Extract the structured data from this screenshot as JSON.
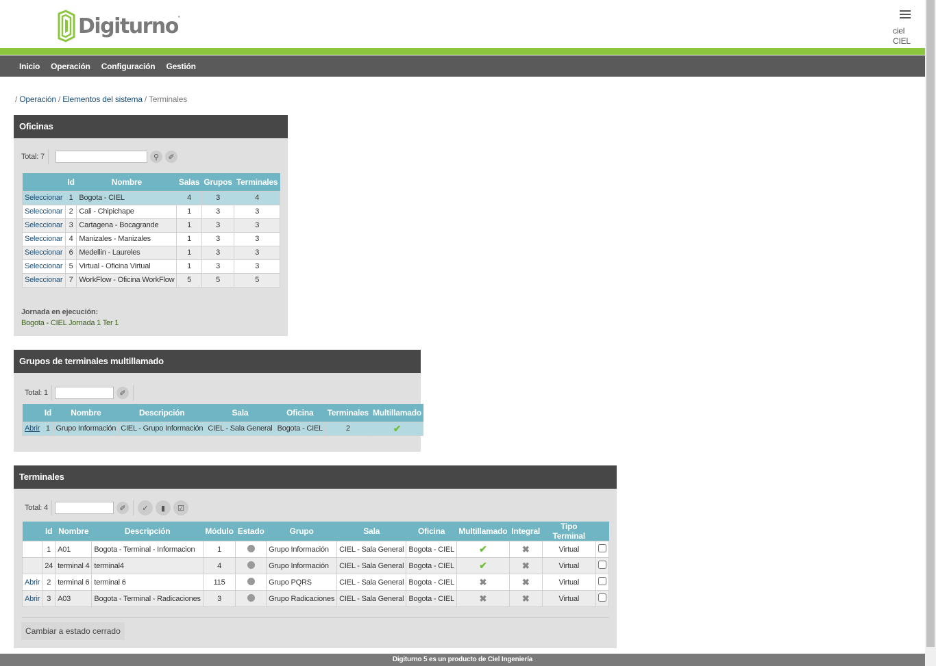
{
  "header": {
    "logo_text": "Digiturno",
    "user_name": "ciel",
    "user_org": "CIEL",
    "menu_icon": "hamburger-icon"
  },
  "nav": [
    "Inicio",
    "Operación",
    "Configuración",
    "Gestión"
  ],
  "breadcrumb": {
    "lead": "/ ",
    "item1": "Operación",
    "sep": " / ",
    "item2": "Elementos del sistema",
    "current": "Terminales"
  },
  "oficinas": {
    "title": "Oficinas",
    "total_label": "Total:",
    "total": "7",
    "columns": [
      "",
      "Id",
      "Nombre",
      "Salas",
      "Grupos",
      "Terminales"
    ],
    "select_label": "Seleccionar",
    "rows": [
      {
        "id": "1",
        "nombre": "Bogota - CIEL",
        "salas": "4",
        "grupos": "3",
        "terminales": "4"
      },
      {
        "id": "2",
        "nombre": "Cali - Chipichape",
        "salas": "1",
        "grupos": "3",
        "terminales": "3"
      },
      {
        "id": "3",
        "nombre": "Cartagena - Bocagrande",
        "salas": "1",
        "grupos": "3",
        "terminales": "3"
      },
      {
        "id": "4",
        "nombre": "Manizales - Manizales",
        "salas": "1",
        "grupos": "3",
        "terminales": "3"
      },
      {
        "id": "6",
        "nombre": "Medellin - Laureles",
        "salas": "1",
        "grupos": "3",
        "terminales": "3"
      },
      {
        "id": "5",
        "nombre": "Virtual - Oficina Virtual",
        "salas": "1",
        "grupos": "3",
        "terminales": "3"
      },
      {
        "id": "7",
        "nombre": "WorkFlow - Oficina WorkFlow",
        "salas": "5",
        "grupos": "5",
        "terminales": "5"
      }
    ],
    "jornada_label": "Jornada en ejecución:",
    "jornada_value": "Bogota - CIEL Jornada 1 Ter 1"
  },
  "grupos": {
    "title": "Grupos de terminales multillamado",
    "total_label": "Total:",
    "total": "1",
    "columns": [
      "",
      "Id",
      "Nombre",
      "Descripción",
      "Sala",
      "Oficina",
      "Terminales",
      "Multillamado"
    ],
    "rows": [
      {
        "action": "Abrir",
        "id": "1",
        "nombre": "Grupo Información",
        "descripcion": "CIEL - Grupo Información",
        "sala": "CIEL - Sala General",
        "oficina": "Bogota - CIEL",
        "terminales": "2",
        "multillamado": "check"
      }
    ]
  },
  "terminales": {
    "title": "Terminales",
    "total_label": "Total:",
    "total": "4",
    "columns": [
      "",
      "Id",
      "Nombre",
      "Descripción",
      "Módulo",
      "Estado",
      "Grupo",
      "Sala",
      "Oficina",
      "Multillamado",
      "Integral",
      "Tipo Terminal",
      ""
    ],
    "rows": [
      {
        "action": "",
        "id": "1",
        "nombre": "A01",
        "descripcion": "Bogota - Terminal - Informacion",
        "modulo": "1",
        "grupo": "Grupo Información",
        "sala": "CIEL - Sala General",
        "oficina": "Bogota - CIEL",
        "multillamado": "check",
        "integral": "cross",
        "tipo": "Virtual"
      },
      {
        "action": "",
        "id": "24",
        "nombre": "terminal 4",
        "descripcion": "terminal4",
        "modulo": "4",
        "grupo": "Grupo Información",
        "sala": "CIEL - Sala General",
        "oficina": "Bogota - CIEL",
        "multillamado": "check",
        "integral": "cross",
        "tipo": "Virtual"
      },
      {
        "action": "Abrir",
        "id": "2",
        "nombre": "terminal 6",
        "descripcion": "terminal 6",
        "modulo": "115",
        "grupo": "Grupo PQRS",
        "sala": "CIEL - Sala General",
        "oficina": "Bogota - CIEL",
        "multillamado": "cross",
        "integral": "cross",
        "tipo": "Virtual"
      },
      {
        "action": "Abrir",
        "id": "3",
        "nombre": "A03",
        "descripcion": "Bogota - Terminal - Radicaciones",
        "modulo": "3",
        "grupo": "Grupo Radicaciones",
        "sala": "CIEL - Sala General",
        "oficina": "Bogota - CIEL",
        "multillamado": "cross",
        "integral": "cross",
        "tipo": "Virtual"
      }
    ],
    "button_label": "Cambiar a estado cerrado"
  },
  "footer": "Digiturno 5 es un producto de Ciel Ingeniería",
  "colors": {
    "green_bar": "#8cc63f",
    "table_header": "#6fb5c3",
    "panel_header": "#474747",
    "navbar": "#5a5a5a"
  }
}
